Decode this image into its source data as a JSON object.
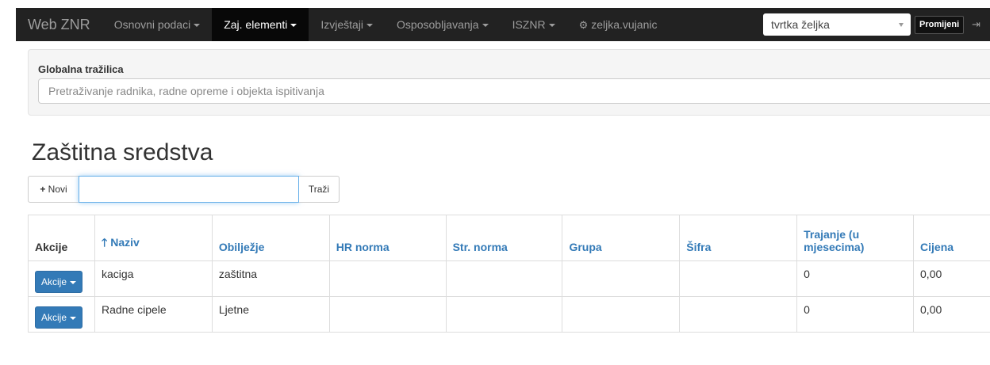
{
  "navbar": {
    "brand": "Web ZNR",
    "menus": [
      {
        "label": "Osnovni podaci",
        "active": false
      },
      {
        "label": "Zaj. elementi",
        "active": true
      },
      {
        "label": "Izvještaji",
        "active": false
      },
      {
        "label": "Osposobljavanja",
        "active": false
      },
      {
        "label": "ISZNR",
        "active": false
      }
    ],
    "user": "zeljka.vujanic",
    "company": "tvrtka željka",
    "change_label": "Promijeni"
  },
  "global_search": {
    "label": "Globalna tražilica",
    "placeholder": "Pretraživanje radnika, radne opreme i objekta ispitivanja"
  },
  "page": {
    "title": "Zaštitna sredstva",
    "new_label": "Novi",
    "search_value": "",
    "search_button": "Traži"
  },
  "table": {
    "headers": {
      "akcije": "Akcije",
      "naziv": "Naziv",
      "obiljezje": "Obilježje",
      "hr_norma": "HR norma",
      "str_norma": "Str. norma",
      "grupa": "Grupa",
      "sifra": "Šifra",
      "trajanje": "Trajanje (u mjesecima)",
      "cijena": "Cijena"
    },
    "action_label": "Akcije",
    "rows": [
      {
        "naziv": "kaciga",
        "obiljezje": "zaštitna",
        "hr_norma": "",
        "str_norma": "",
        "grupa": "",
        "sifra": "",
        "trajanje": "0",
        "cijena": "0,00"
      },
      {
        "naziv": "Radne cipele",
        "obiljezje": "Ljetne",
        "hr_norma": "",
        "str_norma": "",
        "grupa": "",
        "sifra": "",
        "trajanje": "0",
        "cijena": "0,00"
      }
    ]
  },
  "colors": {
    "navbar_bg": "#222222",
    "link": "#337ab7",
    "primary_button": "#337ab7"
  }
}
